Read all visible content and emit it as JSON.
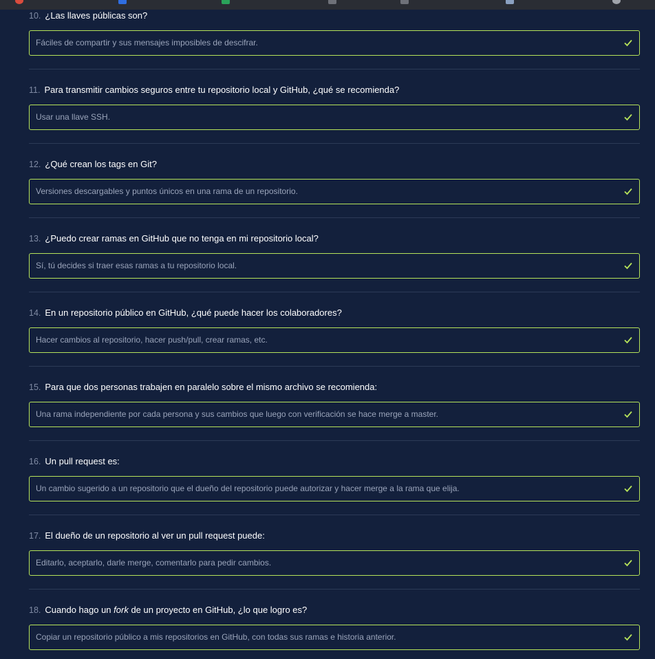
{
  "questions": [
    {
      "num": "10.",
      "text": "¿Las llaves públicas son?",
      "answer": "Fáciles de compartir y sus mensajes imposibles de descifrar."
    },
    {
      "num": "11.",
      "text": "Para transmitir cambios seguros entre tu repositorio local y GitHub, ¿qué se recomienda?",
      "answer": "Usar una llave SSH."
    },
    {
      "num": "12.",
      "text": "¿Qué crean los tags en Git?",
      "answer": "Versiones descargables y puntos únicos en una rama de un repositorio."
    },
    {
      "num": "13.",
      "text": "¿Puedo crear ramas en GitHub que no tenga en mi repositorio local?",
      "answer": "Sí, tú decides si traer esas ramas a tu repositorio local."
    },
    {
      "num": "14.",
      "text": "En un repositorio público en GitHub, ¿qué puede hacer los colaboradores?",
      "answer": "Hacer cambios al repositorio, hacer push/pull, crear ramas, etc."
    },
    {
      "num": "15.",
      "text": "Para que dos personas trabajen en paralelo sobre el mismo archivo se recomienda:",
      "answer": "Una rama independiente por cada persona y sus cambios que luego con verificación se hace merge a master."
    },
    {
      "num": "16.",
      "text": "Un pull request es:",
      "answer": "Un cambio sugerido a un repositorio que el dueño del repositorio puede autorizar y hacer merge a la rama que elija."
    },
    {
      "num": "17.",
      "text": "El dueño de un repositorio al ver un pull request puede:",
      "answer": "Editarlo, aceptarlo, darle merge, comentarlo para pedir cambios."
    },
    {
      "num": "18.",
      "text_before": "Cuando hago un ",
      "text_em": "fork",
      "text_after": " de un proyecto en GitHub, ¿lo que logro es?",
      "answer": "Copiar un repositorio público a mis repositorios en GitHub, con todas sus ramas e historia anterior."
    }
  ],
  "colors": {
    "background": "#13203c",
    "answer_border": "#b6e35a",
    "check": "#b6e35a"
  }
}
